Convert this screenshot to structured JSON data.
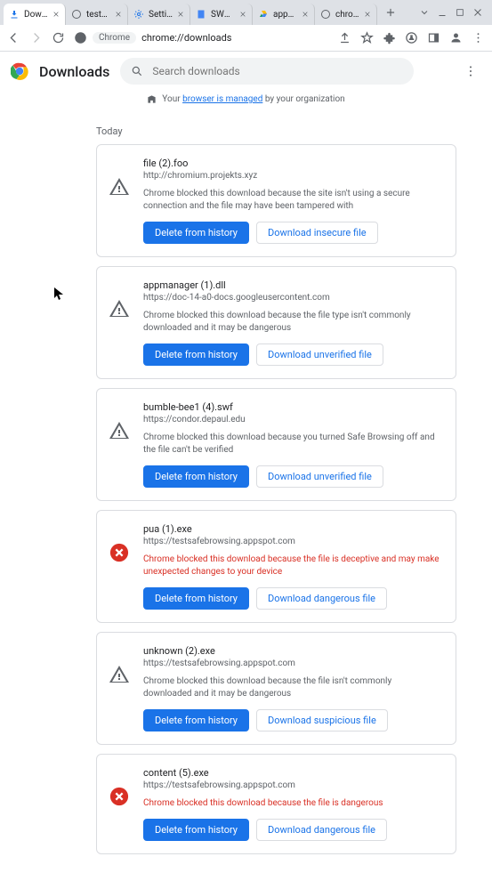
{
  "tabs": [
    {
      "title": "Downloads",
      "active": true
    },
    {
      "title": "testsafebro"
    },
    {
      "title": "Settings - S"
    },
    {
      "title": "SWF File D"
    },
    {
      "title": "appmanage"
    },
    {
      "title": "chromium-"
    }
  ],
  "omnibox": {
    "chip": "Chrome",
    "url": "chrome://downloads"
  },
  "header": {
    "title": "Downloads",
    "search_placeholder": "Search downloads"
  },
  "managed": {
    "prefix": "Your ",
    "link": "browser is managed",
    "suffix": " by your organization"
  },
  "section": "Today",
  "btn_delete": "Delete from history",
  "downloads": [
    {
      "name": "file (2).foo",
      "source": "http://chromium.projekts.xyz",
      "msg": "Chrome blocked this download because the site isn't using a secure connection and the file may have been tampered with",
      "danger": false,
      "icon": "warn",
      "secondary": "Download insecure file"
    },
    {
      "name": "appmanager (1).dll",
      "source": "https://doc-14-a0-docs.googleusercontent.com",
      "msg": "Chrome blocked this download because the file type isn't commonly downloaded and it may be dangerous",
      "danger": false,
      "icon": "warn",
      "secondary": "Download unverified file"
    },
    {
      "name": "bumble-bee1 (4).swf",
      "source": "https://condor.depaul.edu",
      "msg": "Chrome blocked this download because you turned Safe Browsing off and the file can't be verified",
      "danger": false,
      "icon": "warn",
      "secondary": "Download unverified file"
    },
    {
      "name": "pua (1).exe",
      "source": "https://testsafebrowsing.appspot.com",
      "msg": "Chrome blocked this download because the file is deceptive and may make unexpected changes to your device",
      "danger": true,
      "icon": "block",
      "secondary": "Download dangerous file"
    },
    {
      "name": "unknown (2).exe",
      "source": "https://testsafebrowsing.appspot.com",
      "msg": "Chrome blocked this download because the file isn't commonly downloaded and it may be dangerous",
      "danger": false,
      "icon": "warn",
      "secondary": "Download suspicious file"
    },
    {
      "name": "content (5).exe",
      "source": "https://testsafebrowsing.appspot.com",
      "msg": "Chrome blocked this download because the file is dangerous",
      "danger": true,
      "icon": "block",
      "secondary": "Download dangerous file"
    }
  ]
}
